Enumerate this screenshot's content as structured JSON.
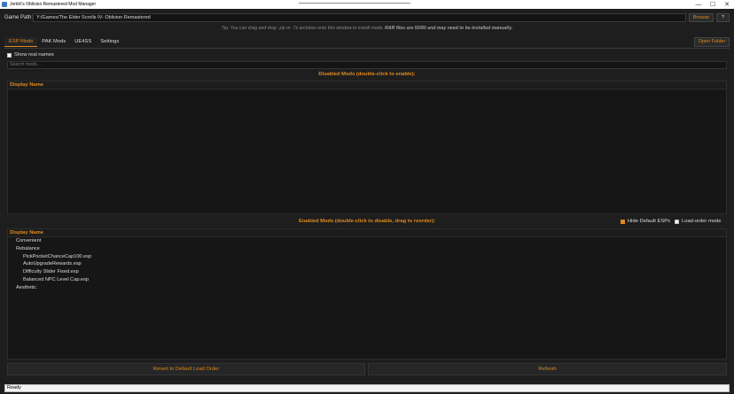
{
  "window": {
    "title": "Jorkk\\'s Oblivion Remastered Mod Manager",
    "controls": {
      "minimize": "—",
      "maximize": "☐",
      "close": "✕"
    }
  },
  "game_path": {
    "label": "Game Path:",
    "value": "Y:/Games/The Elder Scrolls IV- Oblivion Remastered",
    "browse_label": "Browse",
    "help_label": "?"
  },
  "tip": {
    "prefix": "Tip: You can drag and drop .zip or .7z archives onto this window to install mods. ",
    "bold": "RAR files are 50/50 and may need to be installed manually."
  },
  "tabs": [
    {
      "label": "ESP Mods",
      "active": true
    },
    {
      "label": "PAK Mods",
      "active": false
    },
    {
      "label": "UE4SS",
      "active": false
    },
    {
      "label": "Settings",
      "active": false
    }
  ],
  "open_folder_label": "Open Folder",
  "show_real_names": {
    "label": "Show real names",
    "checked": false
  },
  "search": {
    "placeholder": "Search mods..."
  },
  "disabled": {
    "title": "Disabled Mods (double-click to enable):",
    "header": "Display Name",
    "items": []
  },
  "enabled": {
    "title": "Enabled Mods (double-click to disable, drag to reorder):",
    "header": "Display Name",
    "hide_default": {
      "label": "Hide Default ESPs",
      "checked": true
    },
    "load_order": {
      "label": "Load-order mode",
      "checked": false
    },
    "tree": [
      {
        "label": "Convenient",
        "level": 1
      },
      {
        "label": "Rebalance",
        "level": 1
      },
      {
        "label": "PickPocketChanceCap100.esp",
        "level": 2
      },
      {
        "label": "AutoUpgradeRewards.esp",
        "level": 2
      },
      {
        "label": "Difficulty Slider Fixed.esp",
        "level": 2
      },
      {
        "label": "Balanced NPC Level Cap.esp",
        "level": 2
      },
      {
        "label": "Aesthetic",
        "level": 1
      }
    ]
  },
  "buttons": {
    "revert": "Revert to Default Load Order",
    "refresh": "Refresh"
  },
  "status": "Ready",
  "colors": {
    "accent": "#e08a1e",
    "background": "#1e1e1e"
  }
}
